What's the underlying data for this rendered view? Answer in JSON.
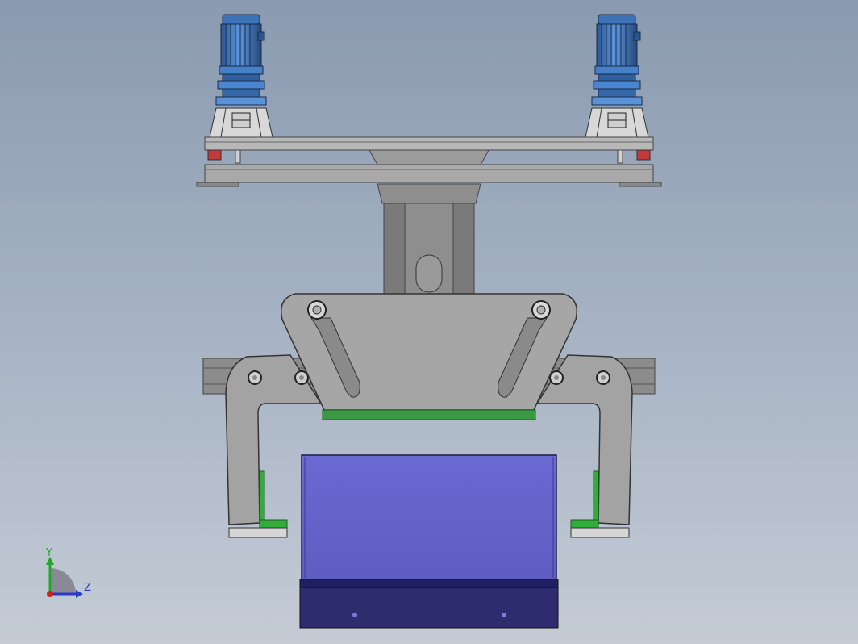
{
  "triad": {
    "y_label": "Y",
    "z_label": "Z"
  },
  "colors": {
    "background_top": "#8a9ab0",
    "background_bottom": "#c4cbd5",
    "metal": "#a8a8a8",
    "metal_dark": "#7e7e7e",
    "motor": "#3f79c2",
    "box_face": "#6a68cc",
    "box_base": "#2c2c6e",
    "pad": "#2fae3a",
    "bearing": "#c23a3a"
  }
}
